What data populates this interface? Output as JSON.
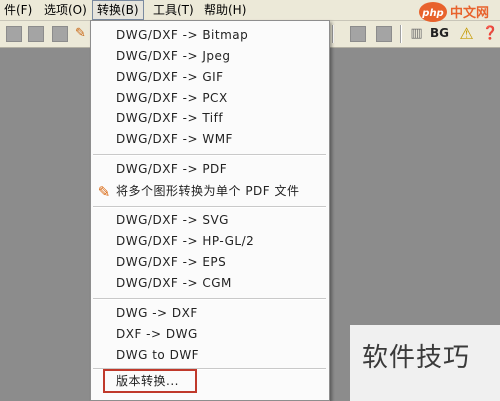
{
  "menubar": {
    "file": "件(F)",
    "options": "选项(O)",
    "convert": "转换(B)",
    "tools": "工具(T)",
    "help": "帮助(H)"
  },
  "toolbar": {
    "bg_label": "BG"
  },
  "convert_menu": {
    "items": [
      "DWG/DXF -> Bitmap",
      "DWG/DXF -> Jpeg",
      "DWG/DXF -> GIF",
      "DWG/DXF -> PCX",
      "DWG/DXF -> Tiff",
      "DWG/DXF -> WMF",
      "DWG/DXF -> PDF",
      "将多个图形转换为单个 PDF 文件",
      "DWG/DXF -> SVG",
      "DWG/DXF -> HP-GL/2",
      "DWG/DXF -> EPS",
      "DWG/DXF -> CGM",
      "DWG -> DXF",
      "DXF -> DWG",
      "DWG to DWF",
      "版本转换..."
    ]
  },
  "watermark_text": "软件技巧",
  "logo_text": "php中文网"
}
